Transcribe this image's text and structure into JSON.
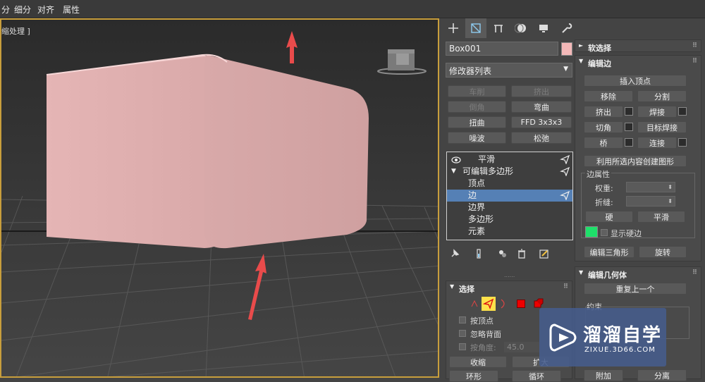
{
  "menu": [
    "分",
    "细分",
    "对齐",
    "属性"
  ],
  "viewport": {
    "label": "缩处理 ]"
  },
  "panel": {
    "tabs": [
      "create-icon",
      "modify-icon",
      "hierarchy-icon",
      "motion-icon",
      "display-icon",
      "utilities-icon"
    ],
    "object_name": "Box001",
    "object_color": "#f3b8b8",
    "modifier_list": "修改器列表",
    "mod_buttons": [
      {
        "label": "车削",
        "enabled": false
      },
      {
        "label": "挤出",
        "enabled": false
      },
      {
        "label": "倒角",
        "enabled": false
      },
      {
        "label": "弯曲",
        "enabled": true
      },
      {
        "label": "扭曲",
        "enabled": true
      },
      {
        "label": "FFD 3x3x3",
        "enabled": true
      },
      {
        "label": "噪波",
        "enabled": true
      },
      {
        "label": "松弛",
        "enabled": true
      }
    ],
    "stack": {
      "smooth": "平滑",
      "editable_poly": "可编辑多边形",
      "sub": [
        "顶点",
        "边",
        "边界",
        "多边形",
        "元素"
      ],
      "selected": "边"
    },
    "selection": {
      "title": "选择",
      "by_vertex": "按顶点",
      "ignore_backface": "忽略背面",
      "by_angle": "按角度:",
      "angle_value": "45.0",
      "shrink": "收缩",
      "grow": "扩大",
      "ring": "环形",
      "loop": "循环"
    },
    "soft_selection": {
      "title": "软选择"
    },
    "edit_edges": {
      "title": "编辑边",
      "insert_vertex": "插入顶点",
      "remove": "移除",
      "split": "分割",
      "extrude": "挤出",
      "weld": "焊接",
      "chamfer": "切角",
      "target_weld": "目标焊接",
      "bridge": "桥",
      "connect": "连接",
      "create_shape": "利用所选内容创建图形",
      "edge_props": "边属性",
      "weight": "权重:",
      "crease": "折缝:",
      "hard": "硬",
      "smooth": "平滑",
      "display_hard": "显示硬边",
      "hard_color": "#1ee06a",
      "edit_tri": "编辑三角形",
      "turn": "旋转"
    },
    "edit_geometry": {
      "title": "编辑几何体",
      "repeat_last": "重复上一个",
      "constraints": "约束",
      "attach": "附加",
      "detach": "分离"
    }
  },
  "watermark": {
    "name": "溜溜自学",
    "url": "ZIXUE.3D66.COM"
  }
}
